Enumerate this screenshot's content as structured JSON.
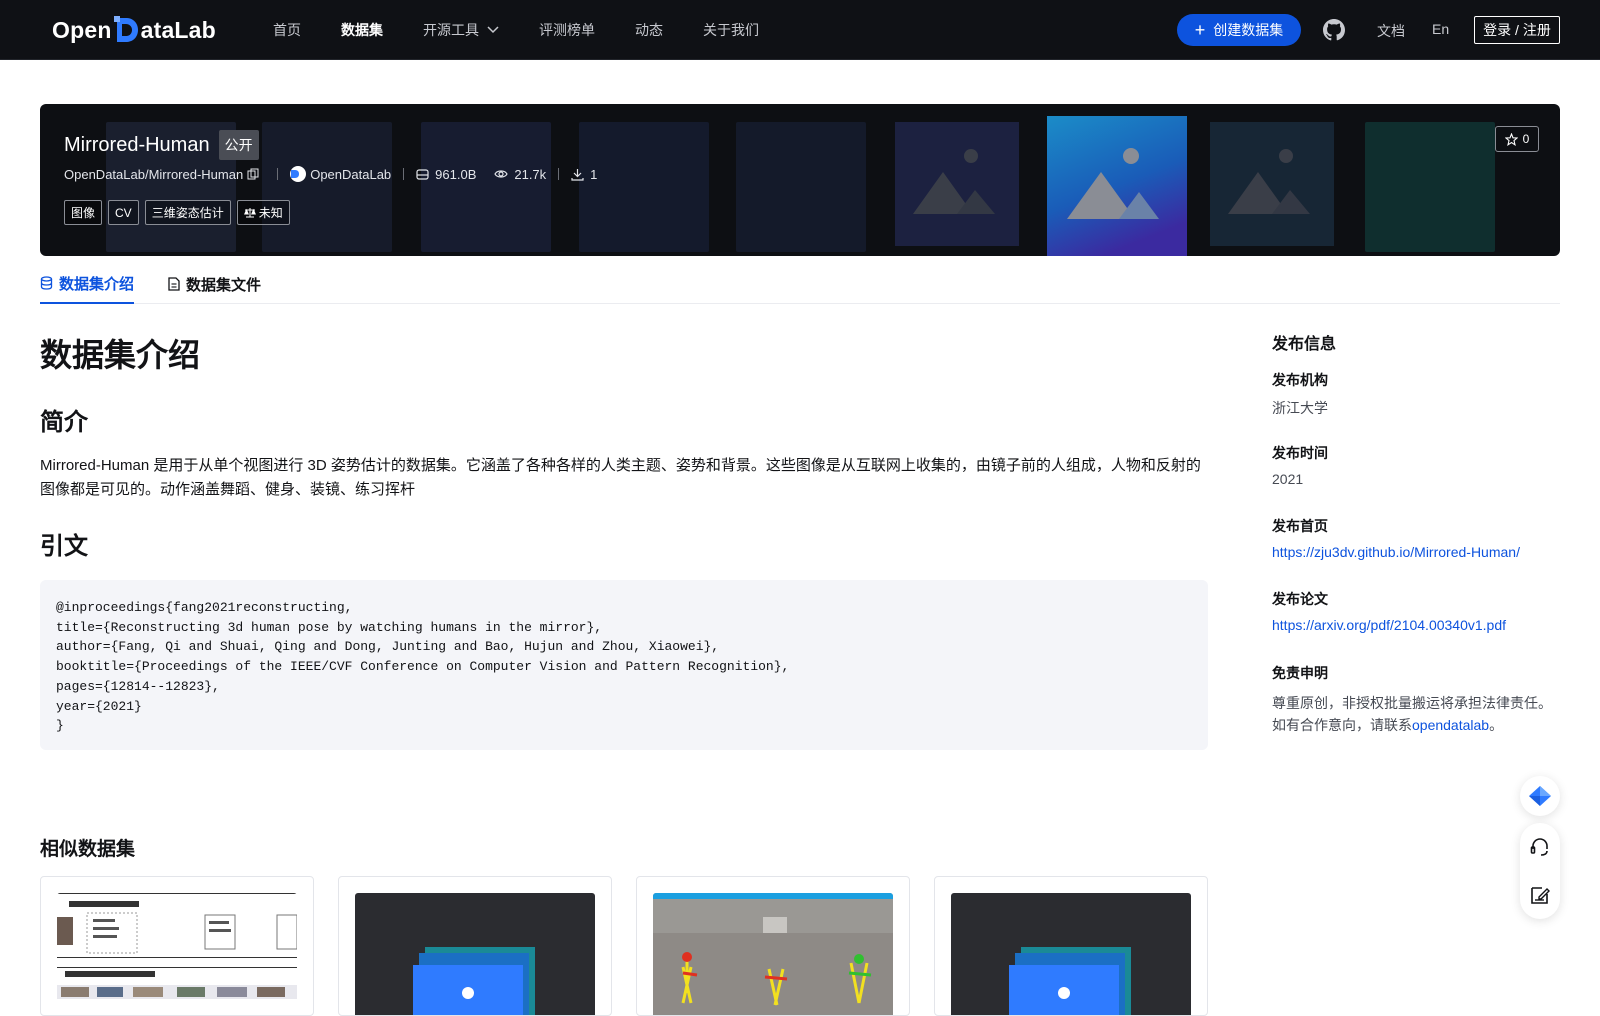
{
  "nav": {
    "logo_pre": "Open",
    "logo_post": "ataLab",
    "links": [
      "首页",
      "数据集",
      "开源工具",
      "评测榜单",
      "动态",
      "关于我们"
    ],
    "active_index": 1,
    "create_label": "创建数据集",
    "docs_label": "文档",
    "lang_label": "En",
    "login_label": "登录 / 注册"
  },
  "banner": {
    "title": "Mirrored-Human",
    "visibility": "公开",
    "repo_path": "OpenDataLab/Mirrored-Human",
    "org": "OpenDataLab",
    "size": "961.0B",
    "views": "21.7k",
    "downloads": "1",
    "tags": [
      "图像",
      "CV",
      "三维姿态估计"
    ],
    "license": "未知",
    "stars": "0"
  },
  "tabs": [
    "数据集介绍",
    "数据集文件"
  ],
  "main": {
    "heading": "数据集介绍",
    "intro_heading": "简介",
    "intro_text": "Mirrored-Human 是用于从单个视图进行 3D 姿势估计的数据集。它涵盖了各种各样的人类主题、姿势和背景。这些图像是从互联网上收集的，由镜子前的人组成，人物和反射的图像都是可见的。动作涵盖舞蹈、健身、装镜、练习挥杆",
    "citation_heading": "引文",
    "citation": "@inproceedings{fang2021reconstructing,\ntitle={Reconstructing 3d human pose by watching humans in the mirror},\nauthor={Fang, Qi and Shuai, Qing and Dong, Junting and Bao, Hujun and Zhou, Xiaowei},\nbooktitle={Proceedings of the IEEE/CVF Conference on Computer Vision and Pattern Recognition},\npages={12814--12823},\nyear={2021}\n}",
    "similar_heading": "相似数据集"
  },
  "sidebar": {
    "title": "发布信息",
    "org_label": "发布机构",
    "org_value": "浙江大学",
    "time_label": "发布时间",
    "time_value": "2021",
    "home_label": "发布首页",
    "home_value": "https://zju3dv.github.io/Mirrored-Human/",
    "paper_label": "发布论文",
    "paper_value": "https://arxiv.org/pdf/2104.00340v1.pdf",
    "disclaimer_label": "免责申明",
    "disclaimer_text_1": "尊重原创，非授权批量搬运将承担法律责任。如有合作意向，请联系",
    "disclaimer_link": "opendatalab",
    "disclaimer_text_2": "。"
  },
  "colors": {
    "brand": "#0d53de",
    "nav_bg": "#0f1115",
    "banner_bg": "#0d0f13"
  }
}
